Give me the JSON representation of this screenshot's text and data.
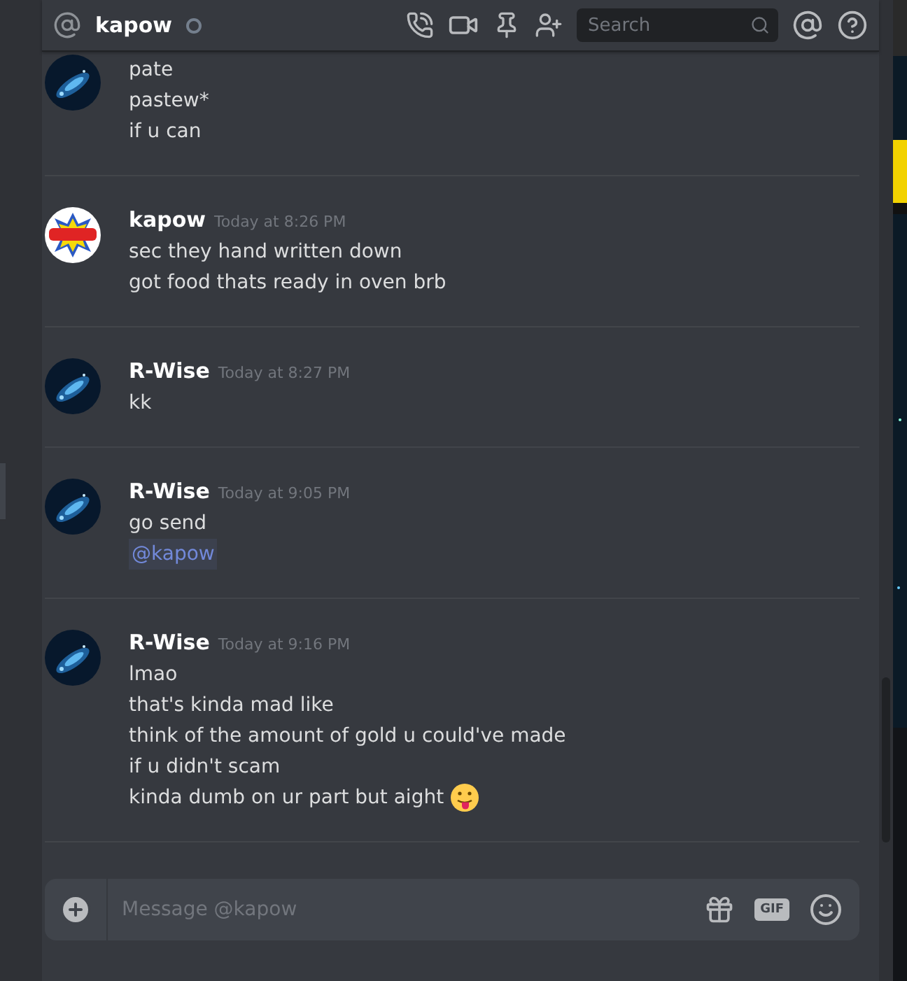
{
  "header": {
    "title": "kapow",
    "online": false,
    "search": {
      "placeholder": "Search"
    }
  },
  "messages": [
    {
      "avatar": {
        "kind": "picture",
        "color": "#07182c"
      },
      "emoji_after": false,
      "lines": [
        {
          "kind": "text",
          "text": "pate"
        },
        {
          "kind": "text",
          "text": "pastew*"
        },
        {
          "kind": "text",
          "text": "if u can"
        }
      ]
    },
    {
      "author": "kapow",
      "time": "Today at 8:26 PM",
      "avatar": {
        "kind": "picture",
        "color": "#ffffff"
      },
      "emoji_after": false,
      "lines": [
        {
          "kind": "text",
          "text": "sec they hand written down"
        },
        {
          "kind": "text",
          "text": "got food thats ready in oven brb"
        }
      ]
    },
    {
      "author": "R-Wise",
      "time": "Today at 8:27 PM",
      "avatar": {
        "kind": "picture",
        "color": "#07182c"
      },
      "emoji_after": false,
      "lines": [
        {
          "kind": "text",
          "text": "kk"
        }
      ]
    },
    {
      "author": "R-Wise",
      "time": "Today at 9:05 PM",
      "avatar": {
        "kind": "picture",
        "color": "#07182c"
      },
      "emoji_after": false,
      "lines": [
        {
          "kind": "text",
          "text": "go send"
        },
        {
          "kind": "mention",
          "text": "@kapow"
        }
      ]
    },
    {
      "author": "R-Wise",
      "time": "Today at 9:16 PM",
      "avatar": {
        "kind": "picture",
        "color": "#07182c"
      },
      "emoji_after": true,
      "lines": [
        {
          "kind": "text",
          "text": "lmao"
        },
        {
          "kind": "text",
          "text": "that's kinda mad like"
        },
        {
          "kind": "text",
          "text": "think of the amount of gold u could've made"
        },
        {
          "kind": "text",
          "text": "if u didn't scam"
        },
        {
          "kind": "text",
          "text": "kinda dumb on ur part but aight"
        }
      ]
    }
  ],
  "composer": {
    "placeholder": "Message @kapow",
    "gif_label": "GIF"
  }
}
